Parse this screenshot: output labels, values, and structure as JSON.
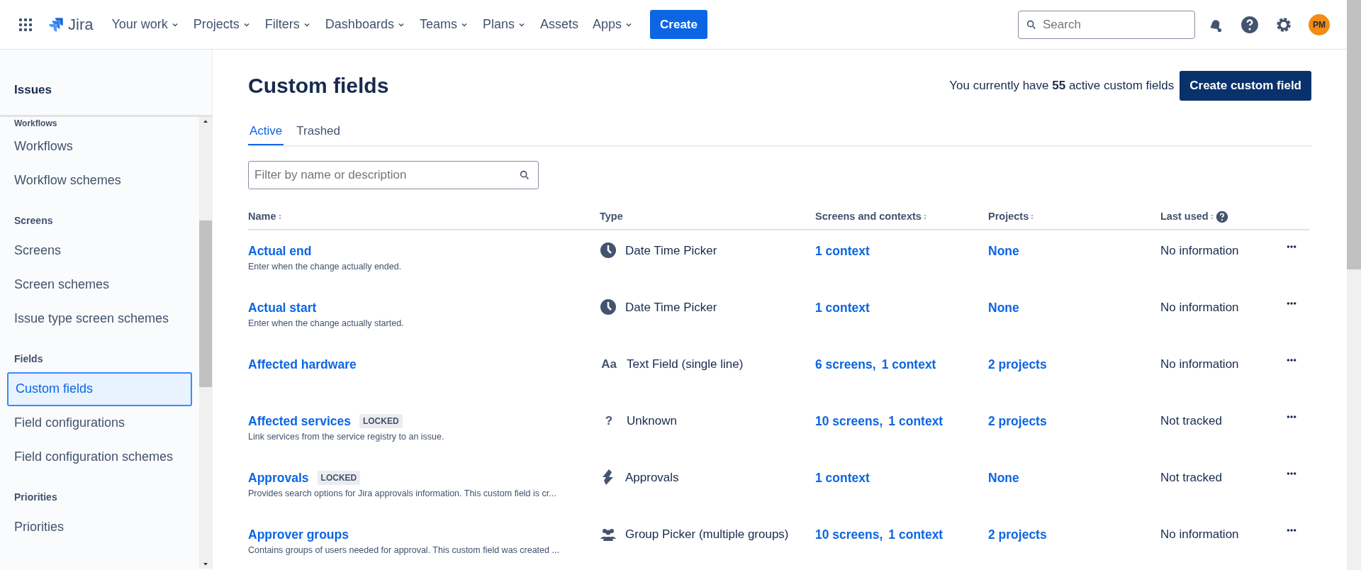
{
  "topbar": {
    "product": "Jira",
    "menus": [
      {
        "label": "Your work",
        "dropdown": true
      },
      {
        "label": "Projects",
        "dropdown": true
      },
      {
        "label": "Filters",
        "dropdown": true
      },
      {
        "label": "Dashboards",
        "dropdown": true
      },
      {
        "label": "Teams",
        "dropdown": true
      },
      {
        "label": "Plans",
        "dropdown": true
      },
      {
        "label": "Assets",
        "dropdown": false
      },
      {
        "label": "Apps",
        "dropdown": true
      }
    ],
    "create": "Create",
    "search": {
      "placeholder": "Search"
    },
    "avatar": "PM"
  },
  "sidebar": {
    "title": "Issues",
    "cut_heading": "Workflows",
    "groups": [
      {
        "items": [
          {
            "label": "Workflows",
            "selected": false
          },
          {
            "label": "Workflow schemes",
            "selected": false
          }
        ]
      },
      {
        "heading": "Screens",
        "items": [
          {
            "label": "Screens",
            "selected": false
          },
          {
            "label": "Screen schemes",
            "selected": false
          },
          {
            "label": "Issue type screen schemes",
            "selected": false
          }
        ]
      },
      {
        "heading": "Fields",
        "items": [
          {
            "label": "Custom fields",
            "selected": true
          },
          {
            "label": "Field configurations",
            "selected": false
          },
          {
            "label": "Field configuration schemes",
            "selected": false
          }
        ]
      },
      {
        "heading": "Priorities",
        "items": [
          {
            "label": "Priorities",
            "selected": false
          }
        ]
      }
    ]
  },
  "page": {
    "title": "Custom fields",
    "summary": "You currently have **55** active custom fields",
    "create_button": "Create custom field",
    "tabs": [
      {
        "label": "Active",
        "selected": true
      },
      {
        "label": "Trashed",
        "selected": false
      }
    ],
    "filter": {
      "placeholder": "Filter by name or description"
    }
  },
  "table": {
    "columns": [
      {
        "label": "Name",
        "sortable": true,
        "help": false
      },
      {
        "label": "Type",
        "sortable": false,
        "help": false
      },
      {
        "label": "Screens and contexts",
        "sortable": true,
        "help": false
      },
      {
        "label": "Projects",
        "sortable": true,
        "help": false
      },
      {
        "label": "Last used",
        "sortable": true,
        "help": true
      }
    ],
    "rows": [
      {
        "name": "Actual end",
        "locked": false,
        "description": "Enter when the change actually ended.",
        "type": {
          "kind": "clock",
          "text": "Date Time Picker"
        },
        "screens": [
          "1 context"
        ],
        "projects": "None",
        "last_used": "No information"
      },
      {
        "name": "Actual start",
        "locked": false,
        "description": "Enter when the change actually started.",
        "type": {
          "kind": "clock",
          "text": "Date Time Picker"
        },
        "screens": [
          "1 context"
        ],
        "projects": "None",
        "last_used": "No information"
      },
      {
        "name": "Affected hardware",
        "locked": false,
        "type": {
          "kind": "glyph",
          "glyph": "Aa",
          "text": "Text Field (single line)"
        },
        "screens": [
          "6 screens,",
          "1 context"
        ],
        "projects": "2 projects",
        "last_used": "No information"
      },
      {
        "name": "Affected services",
        "locked": true,
        "locked_label": "LOCKED",
        "description": "Link services from the service registry to an issue.",
        "type": {
          "kind": "glyph",
          "glyph": "?",
          "text": "Unknown"
        },
        "screens": [
          "10 screens,",
          "1 context"
        ],
        "projects": "2 projects",
        "last_used": "Not tracked"
      },
      {
        "name": "Approvals",
        "locked": true,
        "locked_label": "LOCKED",
        "description": "Provides search options for Jira approvals information. This custom field is cr...",
        "type": {
          "kind": "bolt",
          "text": "Approvals"
        },
        "screens": [
          "1 context"
        ],
        "projects": "None",
        "last_used": "Not tracked"
      },
      {
        "name": "Approver groups",
        "locked": false,
        "description": "Contains groups of users needed for approval. This custom field was created ...",
        "type": {
          "kind": "group",
          "text": "Group Picker (multiple groups)"
        },
        "screens": [
          "10 screens,",
          "1 context"
        ],
        "projects": "2 projects",
        "last_used": "No information"
      }
    ]
  }
}
